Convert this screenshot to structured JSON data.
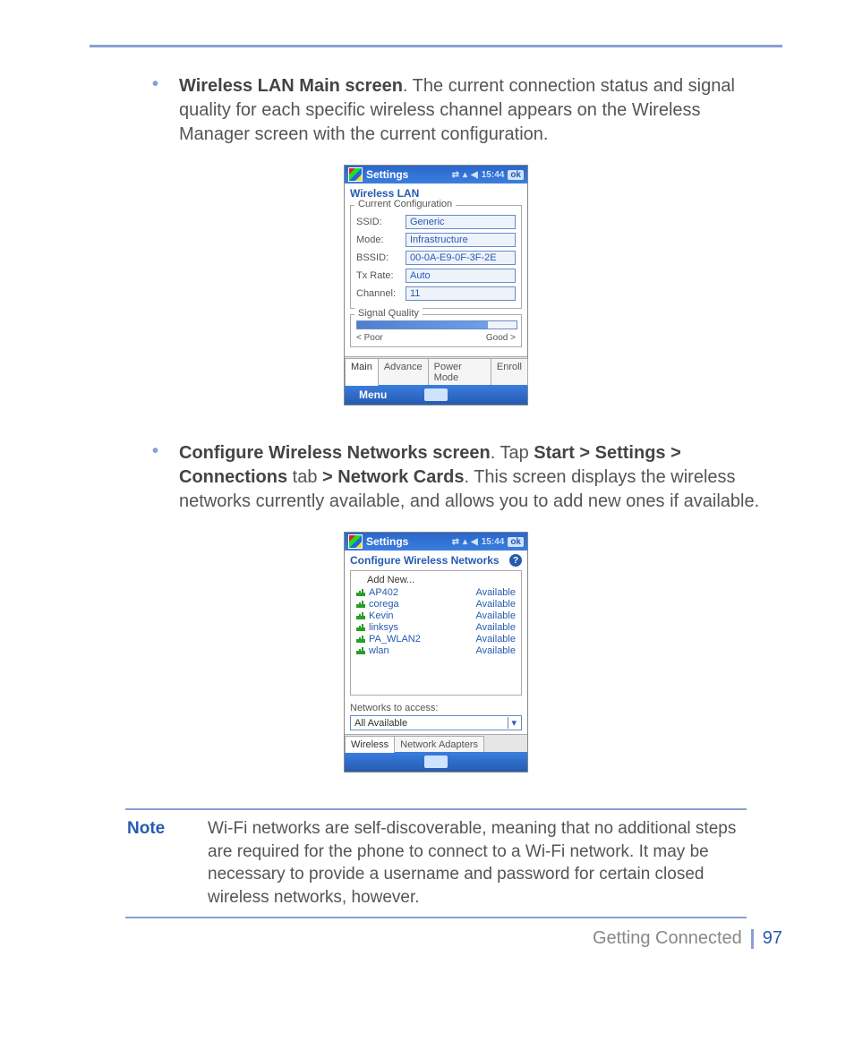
{
  "para1": {
    "title": "Wireless LAN Main screen",
    "text_after": ". The current connection status and signal quality for each specific wireless channel appears on the Wireless Manager screen with the current configuration."
  },
  "para2": {
    "title": "Configure Wireless Networks screen",
    "t1": ". Tap ",
    "path1": "Start > Settings > Connections",
    "t2": " tab ",
    "path2": "> Network Cards",
    "t3": ". This screen displays the wireless networks currently available, and allows you to add new ones if available."
  },
  "pda_shared": {
    "titlebar": "Settings",
    "time": "15:44",
    "ok": "ok"
  },
  "screen1": {
    "subtitle": "Wireless LAN",
    "group1_legend": "Current Configuration",
    "rows": {
      "ssid_label": "SSID:",
      "ssid_value": "Generic",
      "mode_label": "Mode:",
      "mode_value": "Infrastructure",
      "bssid_label": "BSSID:",
      "bssid_value": "00-0A-E9-0F-3F-2E",
      "txrate_label": "Tx Rate:",
      "txrate_value": "Auto",
      "channel_label": "Channel:",
      "channel_value": "11"
    },
    "group2_legend": "Signal Quality",
    "poor": "< Poor",
    "good": "Good >",
    "tabs": {
      "t1": "Main",
      "t2": "Advance",
      "t3": "Power Mode",
      "t4": "Enroll"
    },
    "menu": "Menu"
  },
  "screen2": {
    "subtitle": "Configure Wireless Networks",
    "addnew": "Add New...",
    "networks": [
      {
        "name": "AP402",
        "status": "Available"
      },
      {
        "name": "corega",
        "status": "Available"
      },
      {
        "name": "Kevin",
        "status": "Available"
      },
      {
        "name": "linksys",
        "status": "Available"
      },
      {
        "name": "PA_WLAN2",
        "status": "Available"
      },
      {
        "name": "wlan",
        "status": "Available"
      }
    ],
    "access_label": "Networks to access:",
    "access_value": "All Available",
    "tabs": {
      "t1": "Wireless",
      "t2": "Network Adapters"
    }
  },
  "note": {
    "label": "Note",
    "text": "Wi-Fi networks are self-discoverable, meaning that no additional steps are required for the phone to connect to a Wi-Fi network. It may be necessary to provide a username and password for certain closed wireless networks, however."
  },
  "footer": {
    "section": "Getting Connected",
    "page": "97"
  }
}
